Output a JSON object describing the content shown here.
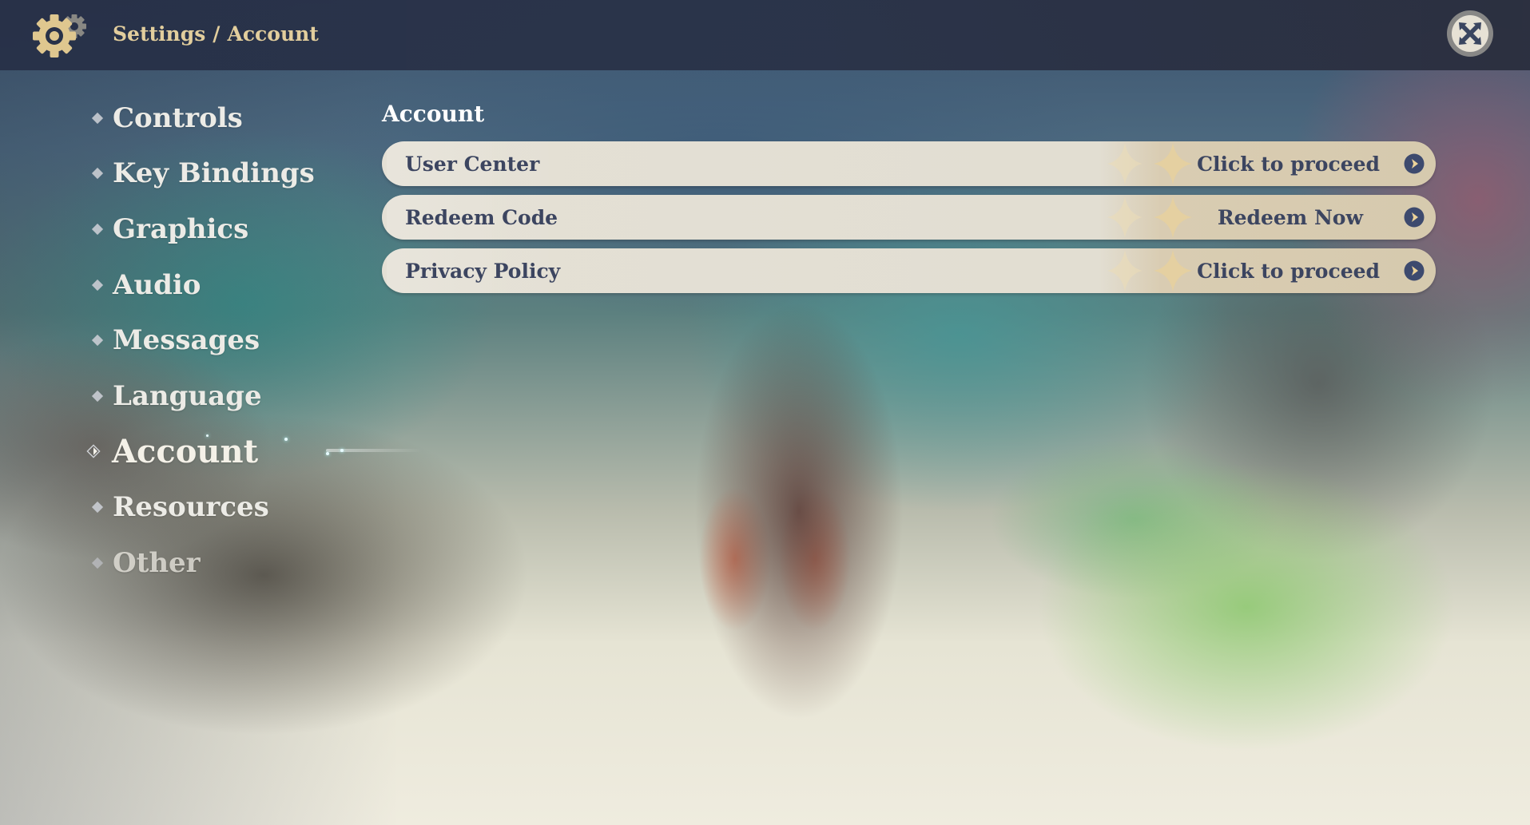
{
  "header": {
    "breadcrumb": {
      "root": "Settings",
      "separator": "/",
      "current": "Account"
    },
    "icons": {
      "settings": "gear-icon",
      "close": "close-icon"
    }
  },
  "sidebar": {
    "items": [
      {
        "label": "Controls",
        "active": false
      },
      {
        "label": "Key Bindings",
        "active": false
      },
      {
        "label": "Graphics",
        "active": false
      },
      {
        "label": "Audio",
        "active": false
      },
      {
        "label": "Messages",
        "active": false
      },
      {
        "label": "Language",
        "active": false
      },
      {
        "label": "Account",
        "active": true
      },
      {
        "label": "Resources",
        "active": false
      },
      {
        "label": "Other",
        "active": false
      }
    ]
  },
  "main": {
    "section_title": "Account",
    "rows": [
      {
        "label": "User Center",
        "action": "Click to proceed",
        "icon": "arrow-right-circle-icon"
      },
      {
        "label": "Redeem Code",
        "action": "Redeem Now",
        "icon": "arrow-right-circle-icon"
      },
      {
        "label": "Privacy Policy",
        "action": "Click to proceed",
        "icon": "arrow-right-circle-icon"
      }
    ]
  },
  "colors": {
    "header_bg": "#283148",
    "breadcrumb_gold": "#e8d29f",
    "row_bg": "#e4e0d5",
    "row_text_navy": "#3c4560",
    "nav_text": "#ecebe6"
  }
}
